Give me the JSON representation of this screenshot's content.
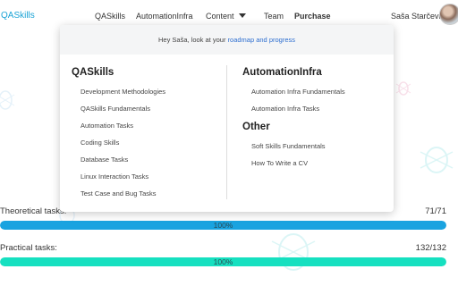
{
  "header": {
    "brand": "QASkills",
    "nav": [
      "QASkills",
      "AutomationInfra",
      "Content",
      "Team",
      "Purchase"
    ],
    "user_name": "Saša Starčević"
  },
  "dropdown": {
    "greeting_prefix": "Hey Saša, look at your ",
    "greeting_link": "roadmap and progress",
    "col_left": {
      "title": "QASkills",
      "items": [
        "Development Methodologies",
        "QASkills Fundamentals",
        "Automation Tasks",
        "Coding Skills",
        "Database Tasks",
        "Linux Interaction Tasks",
        "Test Case and Bug Tasks"
      ]
    },
    "col_right": {
      "title": "AutomationInfra",
      "items": [
        "Automation Infra Fundamentals",
        "Automation Infra Tasks"
      ],
      "other_title": "Other",
      "other_items": [
        "Soft Skills Fundamentals",
        "How To Write a CV"
      ]
    }
  },
  "progress": {
    "theoretical": {
      "label": "Theoretical tasks:",
      "count": "71/71",
      "percent_text": "100%",
      "fill_fraction": 1.0,
      "color": "#1aa3e0"
    },
    "practical": {
      "label": "Practical tasks:",
      "count": "132/132",
      "percent_text": "100%",
      "fill_fraction": 1.0,
      "color": "#16e0c0"
    }
  },
  "colors": {
    "brand": "#1aa3d6",
    "link": "#2e6fd0"
  },
  "icons": [
    "bug-icon",
    "caret-down-icon",
    "avatar"
  ]
}
